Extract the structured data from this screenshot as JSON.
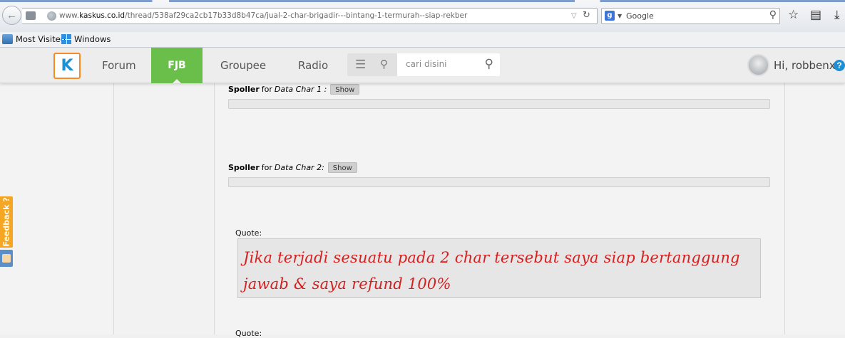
{
  "browser": {
    "url_prefix": "www.",
    "url_host": "kaskus.co.id",
    "url_path": "/thread/538af29ca2cb17b33d8b47ca/jual-2-char-brigadir---bintang-1-termurah--siap-rekber",
    "search_placeholder": "Google",
    "search_engine_letter": "g"
  },
  "bookmarks": [
    {
      "label": "Most Visited"
    },
    {
      "label": "Windows"
    }
  ],
  "site_nav": {
    "logo_letter": "K",
    "items": [
      "Forum",
      "FJB",
      "Groupee",
      "Radio"
    ],
    "search_placeholder": "cari disini",
    "greeting": "Hi, robbenx",
    "help": "?"
  },
  "post": {
    "spoilers": [
      {
        "label": "Spoller",
        "for": "for",
        "title": "Data Char 1 :",
        "button": "Show"
      },
      {
        "label": "Spoller",
        "for": "for",
        "title": "Data Char 2:",
        "button": "Show"
      }
    ],
    "quote_label": "Quote:",
    "quote_text": "Jika terjadi sesuatu pada 2 char tersebut saya siap bertanggung jawab & saya refund 100%",
    "quote_label_2": "Quote:"
  },
  "feedback": {
    "label": "Feedback ?"
  },
  "colors": {
    "fjb_green": "#6abf4b",
    "logo_orange": "#f58c23",
    "quote_red": "#d61f1f",
    "feedback_orange": "#f5a623"
  }
}
